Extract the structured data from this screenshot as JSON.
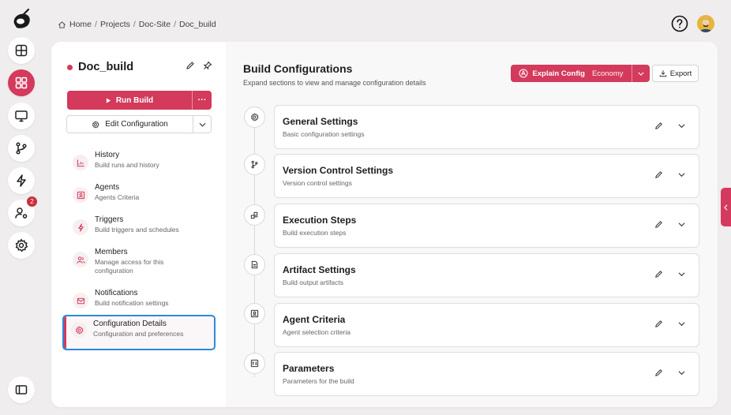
{
  "colors": {
    "accent": "#d33a5c",
    "focus_outline": "#2b8ad8"
  },
  "rail": {
    "items": [
      {
        "icon": "layout-icon"
      },
      {
        "icon": "dashboard-icon",
        "active": true
      },
      {
        "icon": "monitor-icon"
      },
      {
        "icon": "git-branch-icon"
      },
      {
        "icon": "bolt-icon"
      },
      {
        "icon": "users-settings-icon",
        "badge": "2"
      },
      {
        "icon": "gear-icon"
      },
      {
        "icon": "sidebar-toggle-icon"
      }
    ]
  },
  "breadcrumb": {
    "home": "Home",
    "sep": "/",
    "projects": "Projects",
    "site": "Doc-Site",
    "current": "Doc_build"
  },
  "project": {
    "name": "Doc_build",
    "run_label": "Run Build",
    "more_label": "···",
    "edit_label": "Edit Configuration"
  },
  "nav": [
    {
      "title": "History",
      "subtitle": "Build runs and history",
      "icon": "chart-icon"
    },
    {
      "title": "Agents",
      "subtitle": "Agents Criteria",
      "icon": "agent-icon"
    },
    {
      "title": "Triggers",
      "subtitle": "Build triggers and schedules",
      "icon": "bolt-icon"
    },
    {
      "title": "Members",
      "subtitle": "Manage access for this configuration",
      "subtitle_line1": "Manage access for this",
      "subtitle_line2": "configuration",
      "icon": "users-icon"
    },
    {
      "title": "Notifications",
      "subtitle": "Build notification settings",
      "icon": "mail-icon"
    },
    {
      "title": "Configuration Details",
      "subtitle": "Configuration and preferences",
      "icon": "gear-icon",
      "selected": true
    }
  ],
  "main": {
    "title": "Build Configurations",
    "subtitle": "Expand sections to view and manage configuration details",
    "explain_label": "Explain Config",
    "explain_mode": "Economy",
    "export_label": "Export",
    "sections": [
      {
        "title": "General Settings",
        "subtitle": "Basic configuration settings",
        "icon": "gear-icon"
      },
      {
        "title": "Version Control Settings",
        "subtitle": "Version control settings",
        "icon": "git-branch-icon"
      },
      {
        "title": "Execution Steps",
        "subtitle": "Build execution steps",
        "icon": "steps-icon"
      },
      {
        "title": "Artifact Settings",
        "subtitle": "Build output artifacts",
        "icon": "file-icon"
      },
      {
        "title": "Agent Criteria",
        "subtitle": "Agent selection criteria",
        "icon": "agent-icon"
      },
      {
        "title": "Parameters",
        "subtitle": "Parameters for the build",
        "icon": "parameters-icon"
      }
    ]
  }
}
